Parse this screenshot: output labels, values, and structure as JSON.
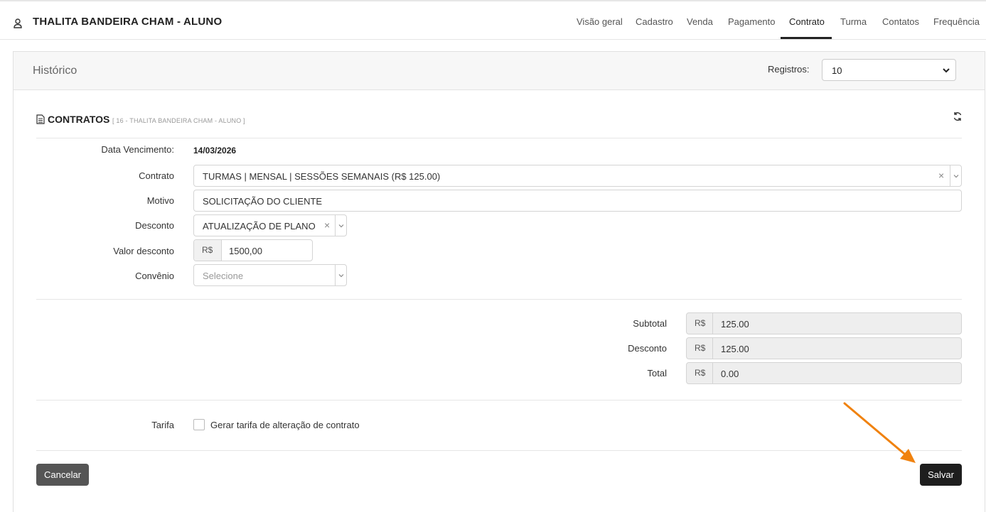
{
  "header": {
    "title": "THALITA BANDEIRA CHAM - ALUNO",
    "tabs": [
      {
        "label": "Visão geral"
      },
      {
        "label": "Cadastro"
      },
      {
        "label": "Venda"
      },
      {
        "label": "Pagamento"
      },
      {
        "label": "Contrato",
        "active": true
      },
      {
        "label": "Turma"
      },
      {
        "label": "Contatos"
      },
      {
        "label": "Frequência"
      }
    ]
  },
  "card": {
    "title": "Histórico",
    "registros_label": "Registros:",
    "registros_value": "10"
  },
  "section": {
    "title": "CONTRATOS",
    "subtitle": "[ 16 - THALITA BANDEIRA CHAM - ALUNO ]"
  },
  "form": {
    "data_vencimento_label": "Data Vencimento:",
    "data_vencimento_value": "14/03/2026",
    "contrato_label": "Contrato",
    "contrato_value": "TURMAS | MENSAL | SESSÕES SEMANAIS (R$ 125.00)",
    "motivo_label": "Motivo",
    "motivo_value": "SOLICITAÇÃO DO CLIENTE",
    "desconto_label": "Desconto",
    "desconto_value": "ATUALIZAÇÃO DE PLANO",
    "valor_desconto_label": "Valor desconto",
    "currency": "R$",
    "valor_desconto_value": "1500,00",
    "convenio_label": "Convênio",
    "convenio_placeholder": "Selecione"
  },
  "totals": {
    "subtotal_label": "Subtotal",
    "subtotal_value": "125.00",
    "desconto_label": "Desconto",
    "desconto_value": "125.00",
    "total_label": "Total",
    "total_value": "0.00"
  },
  "tarifa": {
    "label": "Tarifa",
    "checkbox_label": "Gerar tarifa de alteração de contrato",
    "checked": false
  },
  "actions": {
    "cancel_label": "Cancelar",
    "save_label": "Salvar"
  },
  "colors": {
    "annotation_arrow": "#f0820f",
    "save_button": "#1e1e1e",
    "cancel_button": "#555555"
  }
}
